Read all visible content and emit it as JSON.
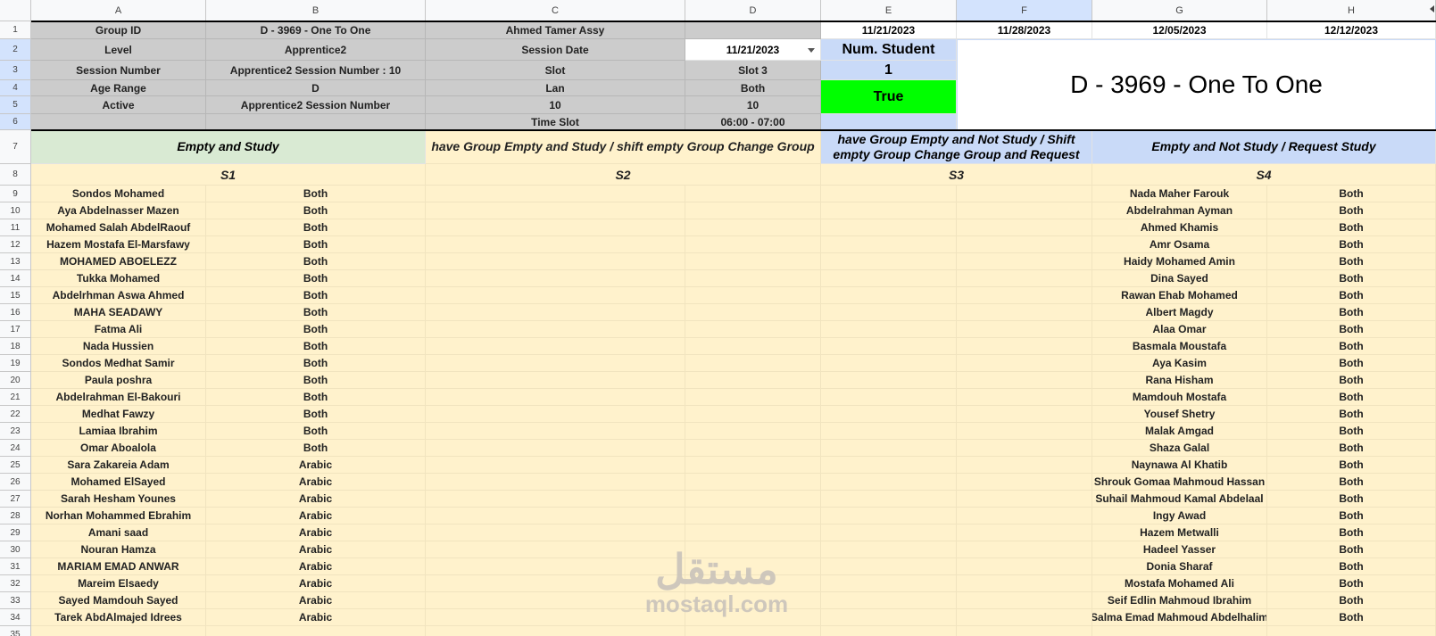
{
  "columns": [
    "A",
    "B",
    "C",
    "D",
    "E",
    "F",
    "G",
    "H"
  ],
  "header": {
    "row1": [
      "Group ID",
      "D - 3969 - One To One",
      "Ahmed Tamer Assy",
      "",
      "11/21/2023",
      "11/28/2023",
      "12/05/2023",
      "12/12/2023"
    ],
    "row2": [
      "Level",
      "Apprentice2",
      "Session Date",
      "11/21/2023",
      "Num. Student"
    ],
    "row3": [
      "Session Number",
      "Apprentice2 Session Number : 10",
      "Slot",
      "Slot 3",
      "1"
    ],
    "row4": [
      "Age Range",
      "D",
      "Lan",
      "Both"
    ],
    "row5": [
      "Active",
      "Apprentice2 Session Number",
      "10",
      "10"
    ],
    "row6": [
      "",
      "",
      "Time Slot",
      "06:00 - 07:00"
    ],
    "status": "True",
    "big_title": "D - 3969 - One To One"
  },
  "sections": {
    "s1_title": "Empty and Study",
    "s2_title": "have Group Empty and Study / shift empty Group Change Group",
    "s3_title": "have Group Empty and Not Study / Shift empty Group Change Group and Request",
    "s4_title": "Empty and Not Study / Request Study",
    "s1": "S1",
    "s2": "S2",
    "s3": "S3",
    "s4": "S4"
  },
  "s1_rows": [
    [
      "Sondos Mohamed",
      "Both"
    ],
    [
      "Aya Abdelnasser Mazen",
      "Both"
    ],
    [
      "Mohamed Salah AbdelRaouf",
      "Both"
    ],
    [
      "Hazem Mostafa El-Marsfawy",
      "Both"
    ],
    [
      "MOHAMED ABOELEZZ",
      "Both"
    ],
    [
      "Tukka Mohamed",
      "Both"
    ],
    [
      "Abdelrhman Aswa Ahmed",
      "Both"
    ],
    [
      "MAHA SEADAWY",
      "Both"
    ],
    [
      "Fatma Ali",
      "Both"
    ],
    [
      "Nada Hussien",
      "Both"
    ],
    [
      "Sondos Medhat Samir",
      "Both"
    ],
    [
      "Paula poshra",
      "Both"
    ],
    [
      "Abdelrahman El-Bakouri",
      "Both"
    ],
    [
      "Medhat Fawzy",
      "Both"
    ],
    [
      "Lamiaa Ibrahim",
      "Both"
    ],
    [
      "Omar Aboalola",
      "Both"
    ],
    [
      "Sara Zakareia Adam",
      "Arabic"
    ],
    [
      "Mohamed ElSayed",
      "Arabic"
    ],
    [
      "Sarah Hesham Younes",
      "Arabic"
    ],
    [
      "Norhan Mohammed Ebrahim",
      "Arabic"
    ],
    [
      "Amani saad",
      "Arabic"
    ],
    [
      "Nouran Hamza",
      "Arabic"
    ],
    [
      "MARIAM EMAD ANWAR",
      "Arabic"
    ],
    [
      "Mareim Elsaedy",
      "Arabic"
    ],
    [
      "Sayed Mamdouh Sayed",
      "Arabic"
    ],
    [
      "Tarek AbdAlmajed Idrees",
      "Arabic"
    ]
  ],
  "s4_rows": [
    [
      "Nada Maher Farouk",
      "Both"
    ],
    [
      "Abdelrahman Ayman",
      "Both"
    ],
    [
      "Ahmed Khamis",
      "Both"
    ],
    [
      "Amr Osama",
      "Both"
    ],
    [
      "Haidy Mohamed Amin",
      "Both"
    ],
    [
      "Dina Sayed",
      "Both"
    ],
    [
      "Rawan Ehab Mohamed",
      "Both"
    ],
    [
      "Albert Magdy",
      "Both"
    ],
    [
      "Alaa Omar",
      "Both"
    ],
    [
      "Basmala Moustafa",
      "Both"
    ],
    [
      "Aya Kasim",
      "Both"
    ],
    [
      "Rana Hisham",
      "Both"
    ],
    [
      "Mamdouh Mostafa",
      "Both"
    ],
    [
      "Yousef Shetry",
      "Both"
    ],
    [
      "Malak Amgad",
      "Both"
    ],
    [
      "Shaza Galal",
      "Both"
    ],
    [
      "Naynawa Al Khatib",
      "Both"
    ],
    [
      "Shrouk Gomaa Mahmoud Hassan",
      "Both"
    ],
    [
      "Suhail Mahmoud Kamal Abdelaal",
      "Both"
    ],
    [
      "Ingy Awad",
      "Both"
    ],
    [
      "Hazem Metwalli",
      "Both"
    ],
    [
      "Hadeel Yasser",
      "Both"
    ],
    [
      "Donia Sharaf",
      "Both"
    ],
    [
      "Mostafa Mohamed Ali",
      "Both"
    ],
    [
      "Seif Edlin Mahmoud Ibrahim",
      "Both"
    ],
    [
      "Salma Emad Mahmoud Abdelhalim",
      "Both"
    ]
  ],
  "watermark": {
    "arabic": "مستقل",
    "latin": "mostaql.com"
  },
  "colors": {
    "gray": "#cccccc",
    "blue": "#c9daf8",
    "green": "#00ff00",
    "light_green": "#d9ead3",
    "beige": "#fff2cc"
  }
}
